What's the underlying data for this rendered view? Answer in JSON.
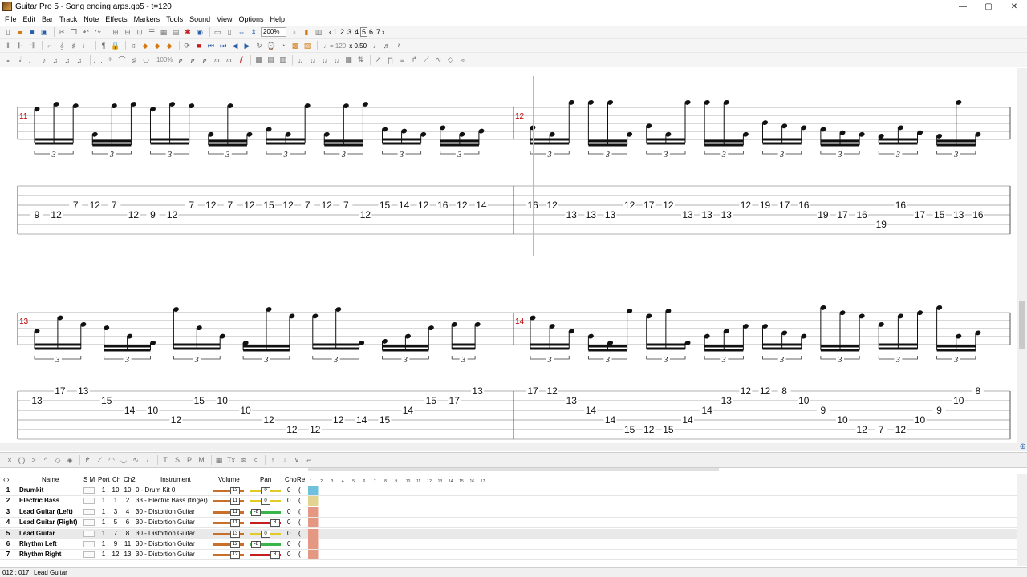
{
  "window": {
    "title": "Guitar Pro 5 - Song ending arps.gp5 - t=120",
    "controls": [
      "—",
      "▢",
      "✕"
    ]
  },
  "menu": [
    "File",
    "Edit",
    "Bar",
    "Track",
    "Note",
    "Effects",
    "Markers",
    "Tools",
    "Sound",
    "View",
    "Options",
    "Help"
  ],
  "toolbar": {
    "zoom": "200%",
    "pages": [
      "1",
      "2",
      "3",
      "4",
      "5",
      "6",
      "7"
    ],
    "active_page": "5",
    "tempo_readout": "♩= 120",
    "speed": "x 0.50",
    "volume_readout": "100%"
  },
  "score": {
    "systems": [
      {
        "bars": [
          {
            "number": "11",
            "tab": [
              {
                "s": 4,
                "f": "9"
              },
              {
                "s": 4,
                "f": "12"
              },
              {
                "s": 3,
                "f": "7"
              },
              {
                "s": 3,
                "f": "12"
              },
              {
                "s": 3,
                "f": "7"
              },
              {
                "s": 4,
                "f": "12"
              },
              {
                "s": 4,
                "f": "9"
              },
              {
                "s": 4,
                "f": "12"
              },
              {
                "s": 3,
                "f": "7"
              },
              {
                "s": 3,
                "f": "12"
              },
              {
                "s": 3,
                "f": "7"
              },
              {
                "s": 3,
                "f": "12"
              },
              {
                "s": 3,
                "f": "15"
              },
              {
                "s": 3,
                "f": "12"
              },
              {
                "s": 3,
                "f": "7"
              },
              {
                "s": 3,
                "f": "12"
              },
              {
                "s": 3,
                "f": "7"
              },
              {
                "s": 4,
                "f": "12"
              },
              {
                "s": 3,
                "f": "15"
              },
              {
                "s": 3,
                "f": "14"
              },
              {
                "s": 3,
                "f": "12"
              },
              {
                "s": 3,
                "f": "16",
                "low": true
              },
              {
                "s": 3,
                "f": "12"
              },
              {
                "s": 3,
                "f": "14"
              }
            ]
          },
          {
            "number": "12",
            "tab": [
              {
                "s": 3,
                "f": "16"
              },
              {
                "s": 3,
                "f": "12"
              },
              {
                "s": 4,
                "f": "13",
                "hi": true
              },
              {
                "s": 4,
                "f": "13"
              },
              {
                "s": 4,
                "f": "13",
                "hi": true
              },
              {
                "s": 3,
                "f": "12"
              },
              {
                "s": 3,
                "f": "17"
              },
              {
                "s": 3,
                "f": "12"
              },
              {
                "s": 4,
                "f": "13",
                "hi": true
              },
              {
                "s": 4,
                "f": "13"
              },
              {
                "s": 4,
                "f": "13",
                "hi": true
              },
              {
                "s": 3,
                "f": "12"
              },
              {
                "s": 3,
                "f": "19"
              },
              {
                "s": 3,
                "f": "17"
              },
              {
                "s": 3,
                "f": "16"
              },
              {
                "s": 4,
                "f": "19"
              },
              {
                "s": 4,
                "f": "17"
              },
              {
                "s": 4,
                "f": "16"
              },
              {
                "s": 5,
                "f": "19"
              },
              {
                "s": 3,
                "f": "16"
              },
              {
                "s": 4,
                "f": "17",
                "hi": true
              },
              {
                "s": 4,
                "f": "15",
                "hi": true
              },
              {
                "s": 4,
                "f": "13",
                "hi": true
              },
              {
                "s": 4,
                "f": "16"
              }
            ]
          }
        ]
      },
      {
        "bars": [
          {
            "number": "13",
            "tab": [
              {
                "s": 2,
                "f": "13"
              },
              {
                "s": 1,
                "f": "17"
              },
              {
                "s": 1,
                "f": "13"
              },
              {
                "s": 2,
                "f": "15"
              },
              {
                "s": 3,
                "f": "14"
              },
              {
                "s": 3,
                "f": "10"
              },
              {
                "s": 4,
                "f": "12"
              },
              {
                "s": 2,
                "f": "15"
              },
              {
                "s": 2,
                "f": "10"
              },
              {
                "s": 3,
                "f": "10"
              },
              {
                "s": 4,
                "f": "12"
              },
              {
                "s": 5,
                "f": "12"
              },
              {
                "s": 5,
                "f": "12"
              },
              {
                "s": 4,
                "f": "12"
              },
              {
                "s": 4,
                "f": "14"
              },
              {
                "s": 4,
                "f": "15"
              },
              {
                "s": 3,
                "f": "14"
              },
              {
                "s": 2,
                "f": "15"
              },
              {
                "s": 2,
                "f": "17"
              },
              {
                "s": 1,
                "f": "13"
              }
            ]
          },
          {
            "number": "14",
            "tab": [
              {
                "s": 1,
                "f": "17"
              },
              {
                "s": 1,
                "f": "12"
              },
              {
                "s": 2,
                "f": "13"
              },
              {
                "s": 3,
                "f": "14"
              },
              {
                "s": 4,
                "f": "14"
              },
              {
                "s": 5,
                "f": "15"
              },
              {
                "s": 5,
                "f": "12"
              },
              {
                "s": 5,
                "f": "15"
              },
              {
                "s": 4,
                "f": "14"
              },
              {
                "s": 3,
                "f": "14"
              },
              {
                "s": 2,
                "f": "13"
              },
              {
                "s": 1,
                "f": "12"
              },
              {
                "s": 1,
                "f": "12"
              },
              {
                "s": 1,
                "f": "8"
              },
              {
                "s": 2,
                "f": "10"
              },
              {
                "s": 3,
                "f": "9"
              },
              {
                "s": 4,
                "f": "10"
              },
              {
                "s": 5,
                "f": "12"
              },
              {
                "s": 5,
                "f": "7"
              },
              {
                "s": 5,
                "f": "12"
              },
              {
                "s": 4,
                "f": "10"
              },
              {
                "s": 3,
                "f": "9"
              },
              {
                "s": 2,
                "f": "10"
              },
              {
                "s": 1,
                "f": "8"
              }
            ]
          }
        ]
      }
    ],
    "tuplet": "3"
  },
  "tracks": {
    "headers": {
      "name": "Name",
      "sm": "S M",
      "port": "Port",
      "ch": "Ch",
      "ch2": "Ch2",
      "instrument": "Instrument",
      "volume": "Volume",
      "pan": "Pan",
      "cho": "Cho",
      "re": "Re"
    },
    "rows": [
      {
        "num": "1",
        "name": "Drumkit",
        "port": "1",
        "ch": "10",
        "ch2": "10",
        "instrument": "0 - Drum Kit 0",
        "vol": "13",
        "pan": "0",
        "pan_pos": 0.5,
        "cho": "0",
        "color": "#6fc0dd",
        "selected": false
      },
      {
        "num": "2",
        "name": "Electric Bass",
        "port": "1",
        "ch": "1",
        "ch2": "2",
        "instrument": "33 - Electric Bass (finger)",
        "vol": "11",
        "pan": "0",
        "pan_pos": 0.5,
        "cho": "0",
        "color": "#e2d390",
        "selected": false
      },
      {
        "num": "3",
        "name": "Lead Guitar (Left)",
        "port": "1",
        "ch": "3",
        "ch2": "4",
        "instrument": "30 - Distortion Guitar",
        "vol": "11",
        "pan": "-8",
        "pan_pos": 0.05,
        "cho": "0",
        "color": "#e49782",
        "selected": false
      },
      {
        "num": "4",
        "name": "Lead Guitar (Right)",
        "port": "1",
        "ch": "5",
        "ch2": "6",
        "instrument": "30 - Distortion Guitar",
        "vol": "11",
        "pan": "8",
        "pan_pos": 0.95,
        "cho": "0",
        "color": "#e49782",
        "selected": false
      },
      {
        "num": "5",
        "name": "Lead Guitar",
        "port": "1",
        "ch": "7",
        "ch2": "8",
        "instrument": "30 - Distortion Guitar",
        "vol": "13",
        "pan": "0",
        "pan_pos": 0.5,
        "cho": "0",
        "color": "#e49782",
        "selected": true
      },
      {
        "num": "6",
        "name": "Rhythm Left",
        "port": "1",
        "ch": "9",
        "ch2": "11",
        "instrument": "30 - Distortion Guitar",
        "vol": "12",
        "pan": "-8",
        "pan_pos": 0.05,
        "cho": "0",
        "color": "#e49782",
        "selected": false
      },
      {
        "num": "7",
        "name": "Rhythm Right",
        "port": "1",
        "ch": "12",
        "ch2": "13",
        "instrument": "30 - Distortion Guitar",
        "vol": "12",
        "pan": "8",
        "pan_pos": 0.95,
        "cho": "0",
        "color": "#e49782",
        "selected": false
      }
    ],
    "bar_numbers": [
      "1",
      "2",
      "3",
      "4",
      "5",
      "6",
      "7",
      "8",
      "9",
      "10",
      "11",
      "12",
      "13",
      "14",
      "15",
      "16",
      "17"
    ]
  },
  "status": {
    "position": "012 : 017",
    "track": "Lead Guitar"
  }
}
